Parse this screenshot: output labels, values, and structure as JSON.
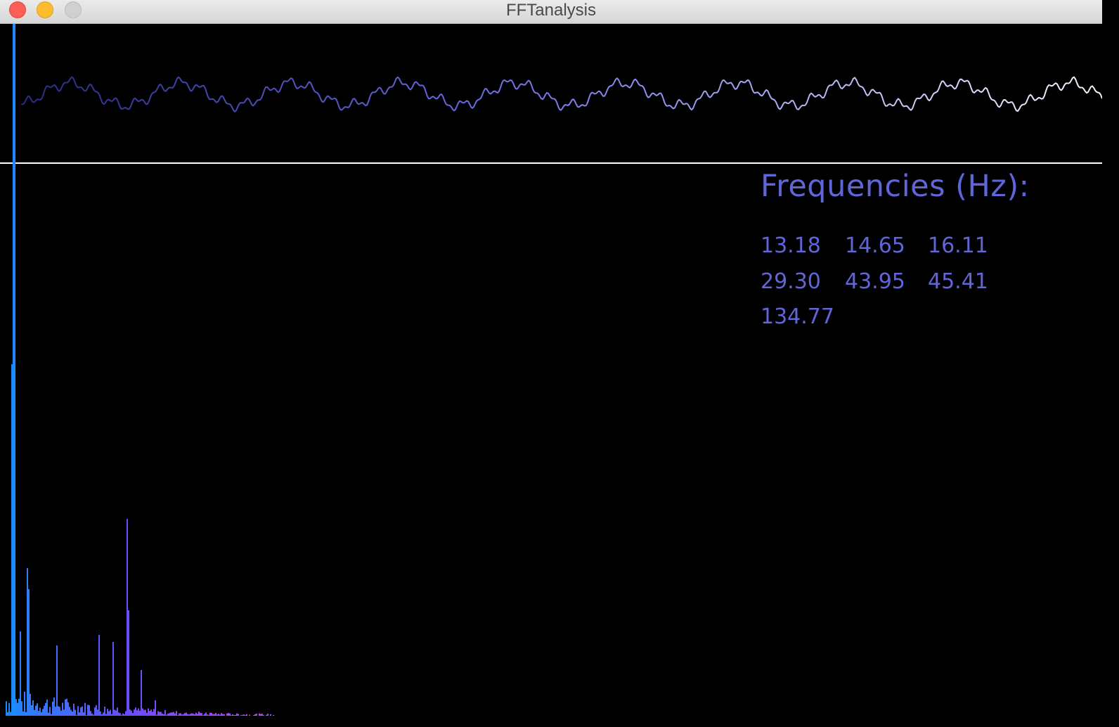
{
  "window": {
    "title": "FFTanalysis",
    "controls": {
      "close": "close-button",
      "minimize": "minimize-button",
      "zoom": "zoom-button"
    }
  },
  "colors": {
    "background": "#000000",
    "accent_text": "#6065d8",
    "divider": "#ffffff",
    "spectrum_low": "#1a8cff",
    "spectrum_mid": "#6a4dff",
    "spectrum_high": "#c040ff",
    "waveform_start": "#2a2a88",
    "waveform_mid": "#6a6ae8",
    "waveform_end": "#f4f4ff",
    "cursor": "#1a8cff"
  },
  "frequencies": {
    "heading": "Frequencies (Hz):",
    "values": [
      "13.18",
      "14.65",
      "16.11",
      "29.30",
      "43.95",
      "45.41",
      "134.77"
    ]
  }
}
